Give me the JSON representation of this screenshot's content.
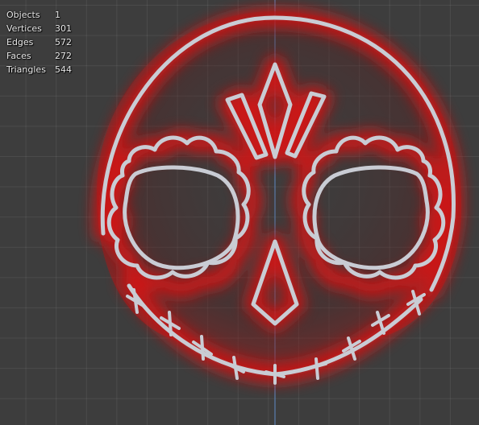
{
  "stats": {
    "rows": [
      {
        "label": "Objects",
        "value": "1"
      },
      {
        "label": "Vertices",
        "value": "301"
      },
      {
        "label": "Edges",
        "value": "572"
      },
      {
        "label": "Faces",
        "value": "272"
      },
      {
        "label": "Triangles",
        "value": "544"
      }
    ]
  },
  "colors": {
    "viewport_background": "#3d3d3d",
    "grid_line": "#4a4a4a",
    "axis_line": "#5a7fb0",
    "glow": "#d01818",
    "wire": "#c9ccd4"
  },
  "scene": {
    "object": "sugar-skull-outline-mesh"
  }
}
